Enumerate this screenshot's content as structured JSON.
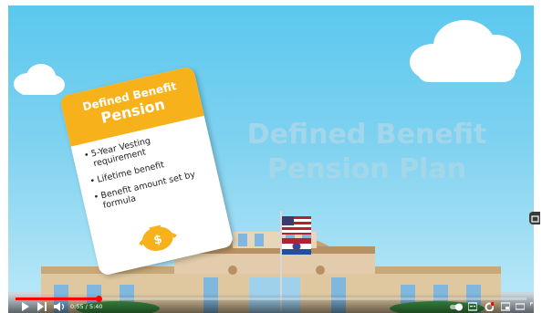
{
  "video": {
    "heading_line1": "Defined Benefit",
    "heading_line2": "Pension Plan",
    "card": {
      "title_line1": "Defined Benefit",
      "title_line2": "Pension",
      "bullets": [
        "5-Year Vesting requirement",
        "Lifetime benefit",
        "Benefit amount set by formula"
      ],
      "icon": "money-bag-icon"
    },
    "flag_icons": [
      "us-flag-icon",
      "missouri-flag-icon"
    ]
  },
  "player": {
    "current_time": "0:55",
    "separator": " / ",
    "duration": "5:40",
    "progress": 0.162,
    "colors": {
      "progress": "#ff0000",
      "sky": "#5bc8ee",
      "card_header": "#f7b21b"
    },
    "left_icons": [
      "play-icon",
      "next-icon",
      "volume-icon"
    ],
    "right_icons": [
      "autoplay-toggle-icon",
      "subtitles-icon",
      "settings-icon",
      "miniplayer-icon",
      "theater-icon",
      "fullscreen-icon"
    ]
  }
}
